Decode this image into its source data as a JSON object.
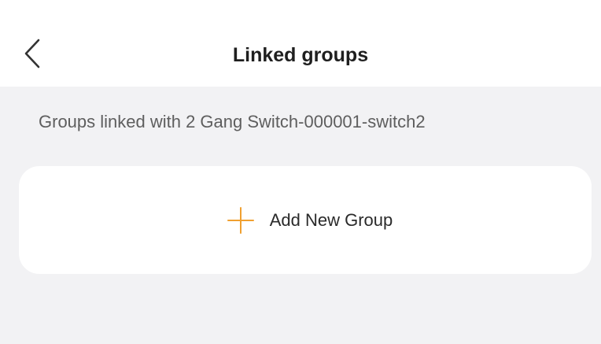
{
  "header": {
    "title": "Linked groups",
    "back_icon": "chevron-left-icon"
  },
  "main": {
    "subtitle": "Groups linked with 2 Gang Switch-000001-switch2",
    "add_group": {
      "label": "Add New Group",
      "icon": "plus-icon",
      "icon_color": "#f0a030"
    }
  },
  "colors": {
    "background": "#f2f2f4",
    "card": "#ffffff",
    "accent": "#f0a030"
  }
}
